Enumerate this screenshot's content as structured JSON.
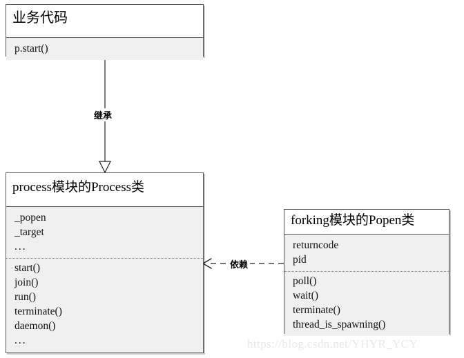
{
  "diagram": {
    "type": "uml-class-diagram",
    "background_color": "#ffffff",
    "border_color": "#555555",
    "compartment_color": "#f0f0f0",
    "title_color": "#ffffff"
  },
  "boxes": {
    "business": {
      "title": "业务代码",
      "members": [
        "p.start()"
      ]
    },
    "process": {
      "title": "process模块的Process类",
      "attributes": [
        "_popen",
        "_target",
        "..."
      ],
      "methods": [
        "start()",
        "join()",
        "run()",
        "terminate()",
        "daemon()",
        "..."
      ]
    },
    "popen": {
      "title": "forking模块的Popen类",
      "attributes": [
        "returncode",
        "pid"
      ],
      "methods": [
        "poll()",
        "wait()",
        "terminate()",
        "thread_is_spawning()"
      ]
    }
  },
  "edges": {
    "inheritance": {
      "label": "继承",
      "from": "business",
      "to": "process",
      "style": "solid",
      "arrowhead": "hollow-triangle"
    },
    "dependency": {
      "label": "依赖",
      "from": "popen",
      "to": "process",
      "style": "dashed",
      "arrowhead": "open-arrow"
    }
  },
  "watermark": {
    "text": "https://blog.csdn.net/YHYR_YCY",
    "color": "#e8e8e8"
  }
}
